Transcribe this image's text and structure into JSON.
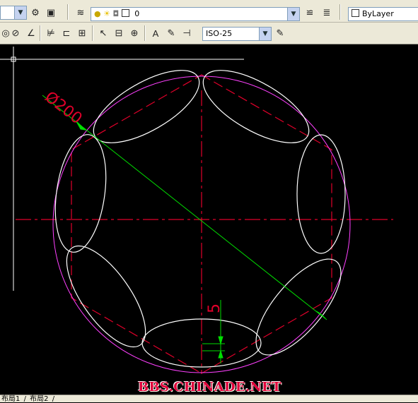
{
  "toolbar1": {
    "layer_name": "0",
    "linetype": "ByLayer",
    "layer_state_icons": [
      "lightbulb-icon",
      "sun-icon",
      "lock-icon",
      "color-swatch-icon"
    ]
  },
  "toolbar2": {
    "dim_style": "ISO-25"
  },
  "drawing": {
    "diameter_label": "Ø200",
    "dimension_label": "5"
  },
  "status_bar": {
    "tabs": [
      "布局1",
      "布局2"
    ]
  },
  "watermark": "BBS.CHINADE.NET",
  "colors": {
    "centerline": "#e0002a",
    "outline": "#ffffff",
    "outer_circle": "#ff40ff",
    "dimension": "#00ff00",
    "background": "#000000"
  }
}
